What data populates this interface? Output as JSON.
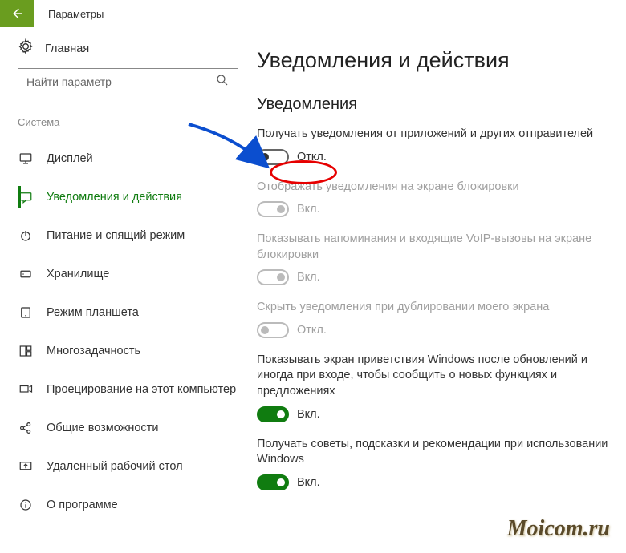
{
  "titlebar": {
    "title": "Параметры"
  },
  "sidebar": {
    "home": "Главная",
    "search_placeholder": "Найти параметр",
    "section": "Система",
    "items": [
      {
        "label": "Дисплей"
      },
      {
        "label": "Уведомления и действия"
      },
      {
        "label": "Питание и спящий режим"
      },
      {
        "label": "Хранилище"
      },
      {
        "label": "Режим планшета"
      },
      {
        "label": "Многозадачность"
      },
      {
        "label": "Проецирование на этот компьютер"
      },
      {
        "label": "Общие возможности"
      },
      {
        "label": "Удаленный рабочий стол"
      },
      {
        "label": "О программе"
      }
    ]
  },
  "main": {
    "page_title": "Уведомления и действия",
    "section_title": "Уведомления",
    "settings": [
      {
        "label": "Получать уведомления от приложений и других отправителей",
        "state": "Откл."
      },
      {
        "label": "Отображать уведомления на экране блокировки",
        "state": "Вкл."
      },
      {
        "label": "Показывать напоминания и входящие VoIP-вызовы на экране блокировки",
        "state": "Вкл."
      },
      {
        "label": "Скрыть уведомления при дублировании моего экрана",
        "state": "Откл."
      },
      {
        "label": "Показывать экран приветствия Windows после обновлений и иногда при входе, чтобы сообщить о новых функциях и предложениях",
        "state": "Вкл."
      },
      {
        "label": "Получать советы, подсказки и рекомендации при использовании Windows",
        "state": "Вкл."
      }
    ]
  },
  "watermark": "Moicom.ru"
}
